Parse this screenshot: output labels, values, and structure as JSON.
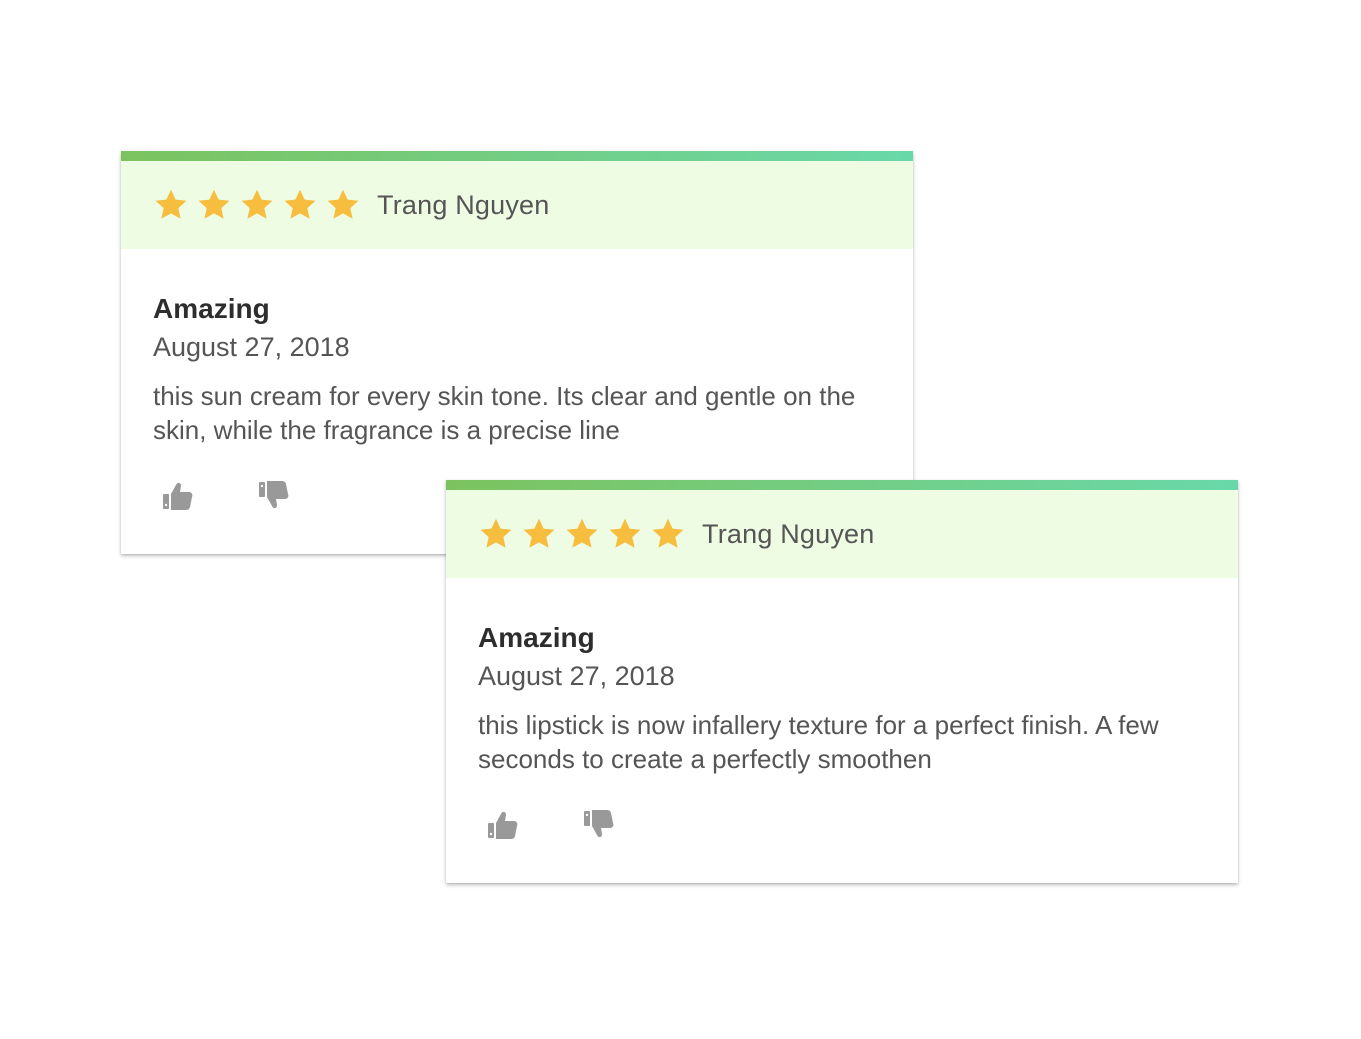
{
  "colors": {
    "accent_gradient_start": "#7cc35f",
    "accent_gradient_end": "#69d8a9",
    "header_background": "#eefce4",
    "star": "#f7bd3f",
    "vote_icon": "#999999"
  },
  "reviews": [
    {
      "rating": 5,
      "max_rating": 5,
      "reviewer": "Trang Nguyen",
      "title": "Amazing",
      "date": "August 27, 2018",
      "text": "this sun cream for every skin tone. Its clear and gentle on the skin, while the fragrance is a precise line",
      "icons": [
        "star-icon",
        "thumbs-up-icon",
        "thumbs-down-icon"
      ]
    },
    {
      "rating": 5,
      "max_rating": 5,
      "reviewer": "Trang Nguyen",
      "title": "Amazing",
      "date": "August 27, 2018",
      "text": "this lipstick is now infallery texture for a perfect finish. A few seconds to create a perfectly smoothen",
      "icons": [
        "star-icon",
        "thumbs-up-icon",
        "thumbs-down-icon"
      ]
    }
  ]
}
